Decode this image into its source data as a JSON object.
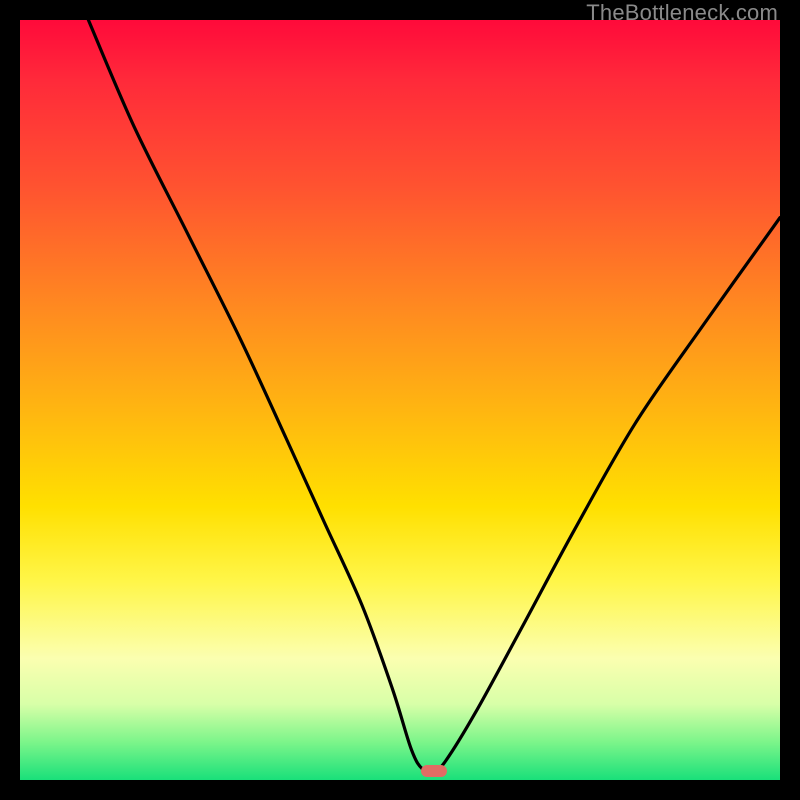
{
  "watermark": "TheBottleneck.com",
  "marker": {
    "x_frac": 0.545,
    "y_frac": 0.988,
    "color": "#e06d64"
  },
  "chart_data": {
    "type": "line",
    "title": "",
    "xlabel": "",
    "ylabel": "",
    "xlim": [
      0,
      100
    ],
    "ylim": [
      0,
      100
    ],
    "grid": false,
    "series": [
      {
        "name": "bottleneck-curve",
        "x": [
          9,
          15,
          22,
          29,
          35,
          40,
          45,
          49,
          51.5,
          53,
          54.5,
          56,
          60,
          66,
          73,
          81,
          90,
          100
        ],
        "y": [
          100,
          86,
          72,
          58,
          45,
          34,
          23,
          12,
          4,
          1.4,
          1.2,
          2.5,
          9,
          20,
          33,
          47,
          60,
          74
        ]
      }
    ],
    "annotations": [
      {
        "type": "marker",
        "x": 54.5,
        "y": 1.2,
        "label": "optimal-point"
      }
    ],
    "legend": false
  }
}
